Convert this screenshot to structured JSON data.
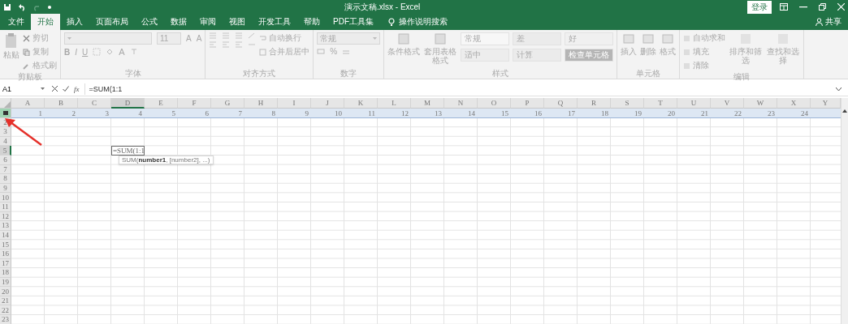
{
  "title_bar": {
    "title": "演示文稿.xlsx  -  Excel",
    "login": "登录"
  },
  "tabs": [
    {
      "label": "文件",
      "selected": false
    },
    {
      "label": "开始",
      "selected": true
    },
    {
      "label": "插入",
      "selected": false
    },
    {
      "label": "页面布局",
      "selected": false
    },
    {
      "label": "公式",
      "selected": false
    },
    {
      "label": "数据",
      "selected": false
    },
    {
      "label": "审阅",
      "selected": false
    },
    {
      "label": "视图",
      "selected": false
    },
    {
      "label": "开发工具",
      "selected": false
    },
    {
      "label": "帮助",
      "selected": false
    },
    {
      "label": "PDF工具集",
      "selected": false
    }
  ],
  "tell_me": "操作说明搜索",
  "share": "共享",
  "ribbon": {
    "disabled": true,
    "groups": [
      {
        "kind": "clipboard",
        "label": "剪贴板",
        "large": [
          "粘贴"
        ],
        "small": [
          "剪切",
          "复制",
          "格式刷"
        ]
      },
      {
        "kind": "font",
        "label": "字体",
        "size": "11",
        "letters": [
          "A",
          "A"
        ],
        "styles": [
          "B",
          "I",
          "U"
        ],
        "font_color": "A"
      },
      {
        "kind": "align",
        "label": "对齐方式",
        "small": [
          "自动换行",
          "合并后居中"
        ]
      },
      {
        "kind": "number",
        "label": "数字",
        "format": "常规",
        "percent": "%"
      },
      {
        "kind": "styles",
        "label": "样式",
        "large": [
          "条件格式",
          "套用表格格式"
        ],
        "cells": [
          {
            "label": "常规",
            "color": "#f7f7f7"
          },
          {
            "label": "差",
            "color": "#ebebeb"
          },
          {
            "label": "好",
            "color": "#f0f0f0"
          },
          {
            "label": "适中",
            "color": "#ededed"
          },
          {
            "label": "计算",
            "color": "#ebebeb"
          },
          {
            "label": "检查单元格",
            "color": "#b5b5b5"
          }
        ]
      },
      {
        "kind": "cells",
        "label": "单元格",
        "large": [
          "插入",
          "删除",
          "格式"
        ]
      },
      {
        "kind": "editing",
        "label": "编辑",
        "small": [
          "自动求和",
          "填充",
          "清除"
        ],
        "large": [
          "排序和筛选",
          "查找和选择"
        ]
      }
    ]
  },
  "formula_bar": {
    "name_box": "A1",
    "function_label": "fx",
    "formula": "=SUM(1:1"
  },
  "columns": [
    {
      "label": "A",
      "active": false
    },
    {
      "label": "B",
      "active": false
    },
    {
      "label": "C",
      "active": false
    },
    {
      "label": "D",
      "active": true
    },
    {
      "label": "E",
      "active": false
    },
    {
      "label": "F",
      "active": false
    },
    {
      "label": "G",
      "active": false
    },
    {
      "label": "H",
      "active": false
    },
    {
      "label": "I",
      "active": false
    },
    {
      "label": "J",
      "active": false
    },
    {
      "label": "K",
      "active": false
    },
    {
      "label": "L",
      "active": false
    },
    {
      "label": "M",
      "active": false
    },
    {
      "label": "N",
      "active": false
    },
    {
      "label": "O",
      "active": false
    },
    {
      "label": "P",
      "active": false
    },
    {
      "label": "Q",
      "active": false
    },
    {
      "label": "R",
      "active": false
    },
    {
      "label": "S",
      "active": false
    },
    {
      "label": "T",
      "active": false
    },
    {
      "label": "U",
      "active": false
    },
    {
      "label": "V",
      "active": false
    },
    {
      "label": "W",
      "active": false
    },
    {
      "label": "X",
      "active": false
    },
    {
      "label": "Y",
      "active": false
    }
  ],
  "rows": [
    {
      "selected": true,
      "active": false,
      "cells": [
        "1",
        "2",
        "3",
        "4",
        "5",
        "6",
        "7",
        "8",
        "9",
        "10",
        "11",
        "12",
        "13",
        "14",
        "15",
        "16",
        "17",
        "18",
        "19",
        "20",
        "21",
        "22",
        "23",
        "24"
      ]
    },
    {
      "label": "2",
      "selected": false,
      "active": false
    },
    {
      "label": "3",
      "selected": false,
      "active": false
    },
    {
      "label": "4",
      "selected": false,
      "active": false
    },
    {
      "label": "5",
      "selected": false,
      "active": true,
      "editing": {
        "text": "=SUM(1:1",
        "tooltip": "SUM(**number1**, [number2], ...)"
      }
    },
    {
      "label": "6",
      "selected": false,
      "active": false
    },
    {
      "label": "7",
      "selected": false,
      "active": false
    },
    {
      "label": "8",
      "selected": false,
      "active": false
    },
    {
      "label": "9",
      "selected": false,
      "active": false
    },
    {
      "label": "10",
      "selected": false,
      "active": false
    },
    {
      "label": "11",
      "selected": false,
      "active": false
    },
    {
      "label": "12",
      "selected": false,
      "active": false
    },
    {
      "label": "13",
      "selected": false,
      "active": false
    },
    {
      "label": "14",
      "selected": false,
      "active": false
    },
    {
      "label": "15",
      "selected": false,
      "active": false
    },
    {
      "label": "16",
      "selected": false,
      "active": false
    },
    {
      "label": "17",
      "selected": false,
      "active": false
    },
    {
      "label": "18",
      "selected": false,
      "active": false
    },
    {
      "label": "19",
      "selected": false,
      "active": false
    },
    {
      "label": "20",
      "selected": false,
      "active": false
    },
    {
      "label": "21",
      "selected": false,
      "active": false
    },
    {
      "label": "22",
      "selected": false,
      "active": false
    },
    {
      "label": "23",
      "selected": false,
      "active": false
    }
  ]
}
